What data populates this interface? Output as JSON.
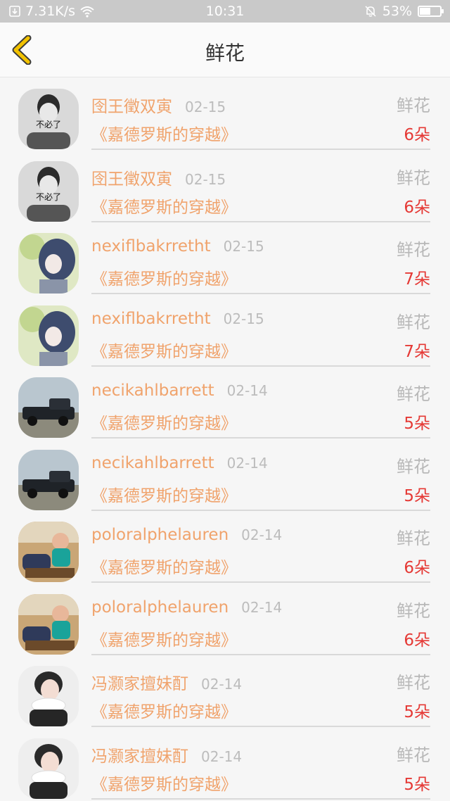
{
  "status_bar": {
    "network_speed": "7.31K/s",
    "time": "10:31",
    "battery": "53%",
    "battery_level": 0.53
  },
  "header": {
    "title": "鲜花"
  },
  "records": [
    {
      "user": "囹王徵双寅",
      "date": "02-15",
      "gift": "鲜花",
      "book": "《嘉德罗斯的穿越》",
      "count": "6朵",
      "avatar_icon": "bw-man-avatar",
      "avatar_text": "不必了"
    },
    {
      "user": "囹王徵双寅",
      "date": "02-15",
      "gift": "鲜花",
      "book": "《嘉德罗斯的穿越》",
      "count": "6朵",
      "avatar_icon": "bw-man-avatar",
      "avatar_text": "不必了"
    },
    {
      "user": "nexiflbakrretht",
      "date": "02-15",
      "gift": "鲜花",
      "book": "《嘉德罗斯的穿越》",
      "count": "7朵",
      "avatar_icon": "anime-girl-avatar"
    },
    {
      "user": "nexiflbakrretht",
      "date": "02-15",
      "gift": "鲜花",
      "book": "《嘉德罗斯的穿越》",
      "count": "7朵",
      "avatar_icon": "anime-girl-avatar"
    },
    {
      "user": "necikahlbarrett",
      "date": "02-14",
      "gift": "鲜花",
      "book": "《嘉德罗斯的穿越》",
      "count": "5朵",
      "avatar_icon": "vintage-car-avatar"
    },
    {
      "user": "necikahlbarrett",
      "date": "02-14",
      "gift": "鲜花",
      "book": "《嘉德罗斯的穿越》",
      "count": "5朵",
      "avatar_icon": "vintage-car-avatar"
    },
    {
      "user": "poloralphelauren",
      "date": "02-14",
      "gift": "鲜花",
      "book": "《嘉德罗斯的穿越》",
      "count": "6朵",
      "avatar_icon": "child-photo-avatar"
    },
    {
      "user": "poloralphelauren",
      "date": "02-14",
      "gift": "鲜花",
      "book": "《嘉德罗斯的穿越》",
      "count": "6朵",
      "avatar_icon": "child-photo-avatar"
    },
    {
      "user": "冯灏家擅妹酊",
      "date": "02-14",
      "gift": "鲜花",
      "book": "《嘉德罗斯的穿越》",
      "count": "5朵",
      "avatar_icon": "white-scarf-person-avatar"
    },
    {
      "user": "冯灏家擅妹酊",
      "date": "02-14",
      "gift": "鲜花",
      "book": "《嘉德罗斯的穿越》",
      "count": "5朵",
      "avatar_icon": "white-scarf-person-avatar"
    }
  ]
}
